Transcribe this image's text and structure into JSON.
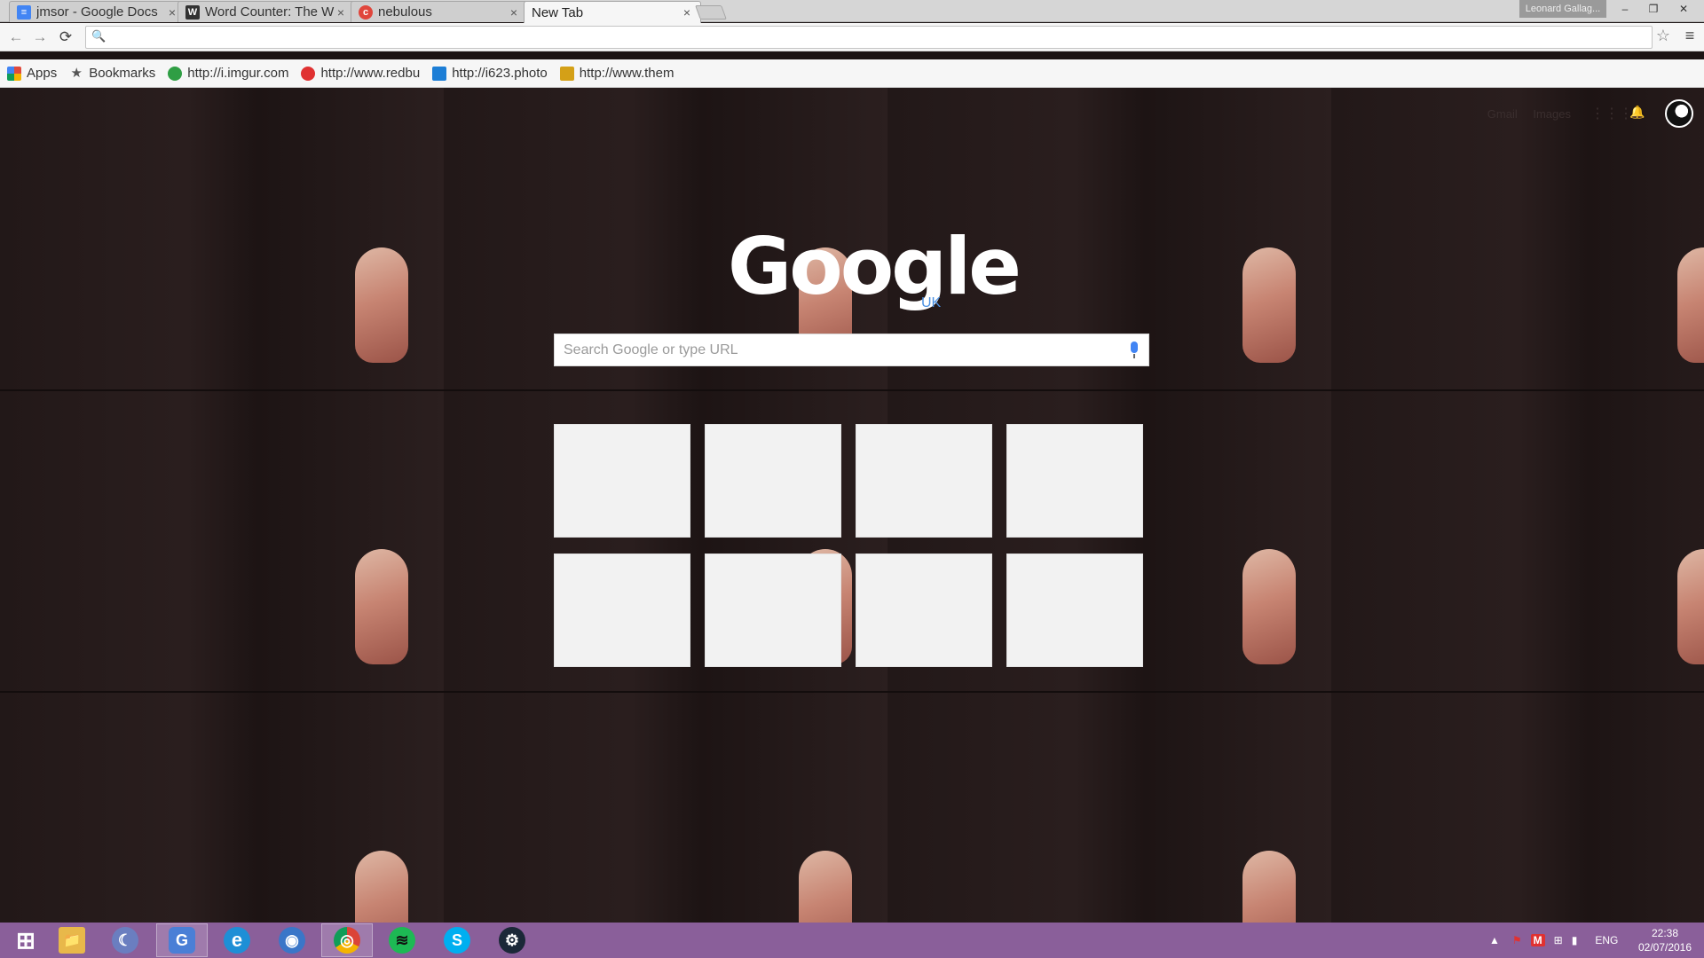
{
  "tabs": [
    {
      "title": "jmsor - Google Docs",
      "favicon": "google-docs-icon",
      "color": "#4285f4",
      "active": false
    },
    {
      "title": "Word Counter: The W",
      "favicon": "w-icon",
      "color": "#333333",
      "active": false
    },
    {
      "title": "nebulous",
      "favicon": "nebulous-icon",
      "color": "#e0463c",
      "active": false
    },
    {
      "title": "New Tab",
      "favicon": "",
      "color": "",
      "active": true
    }
  ],
  "tab_close_glyph": "×",
  "window": {
    "profile_name": "Leonard Gallag...",
    "minimize": "–",
    "restore": "❐",
    "close": "✕"
  },
  "toolbar": {
    "back": "←",
    "forward": "→",
    "reload": "⟳",
    "omnibox_value": "",
    "star": "☆",
    "menu": "≡"
  },
  "bookmarks": [
    {
      "label": "Apps",
      "icon": "apps-grid-icon",
      "color": "#e04a3c"
    },
    {
      "label": "Bookmarks",
      "icon": "star-icon",
      "color": "#555555"
    },
    {
      "label": "http://i.imgur.com",
      "icon": "imgur-icon",
      "color": "#2f9e44"
    },
    {
      "label": "http://www.redbu",
      "icon": "redbubble-icon",
      "color": "#e03131"
    },
    {
      "label": "http://i623.photo",
      "icon": "photobucket-icon",
      "color": "#1c7ed6"
    },
    {
      "label": "http://www.them",
      "icon": "theme-icon",
      "color": "#d4a017"
    }
  ],
  "ntp": {
    "header_links": [
      "Gmail",
      "Images"
    ],
    "logo": "Google",
    "logo_region": "UK",
    "search_placeholder": "Search Google or type URL",
    "most_visited_count": 8
  },
  "taskbar": {
    "apps": [
      {
        "name": "start-button",
        "glyph": "⊞",
        "color": "transparent",
        "pinned": false
      },
      {
        "name": "file-explorer-icon",
        "glyph": "📁",
        "color": "#e8b84a",
        "pinned": false
      },
      {
        "name": "app-moon-icon",
        "glyph": "☾",
        "color": "#6a7ec0",
        "pinned": false
      },
      {
        "name": "app-g-icon",
        "glyph": "G",
        "color": "#4a7fd6",
        "pinned": true
      },
      {
        "name": "internet-explorer-icon",
        "glyph": "e",
        "color": "#1e8fd6",
        "pinned": false
      },
      {
        "name": "app-disc-icon",
        "glyph": "◉",
        "color": "#3a76c8",
        "pinned": false
      },
      {
        "name": "chrome-icon",
        "glyph": "◎",
        "color": "#db4437",
        "pinned": true
      },
      {
        "name": "spotify-icon",
        "glyph": "≋",
        "color": "#1db954",
        "pinned": false
      },
      {
        "name": "skype-icon",
        "glyph": "S",
        "color": "#00aff0",
        "pinned": false
      },
      {
        "name": "steam-icon",
        "glyph": "⚙",
        "color": "#1b2838",
        "pinned": false
      }
    ],
    "tray_lang": "ENG",
    "time": "22:38",
    "date": "02/07/2016"
  }
}
